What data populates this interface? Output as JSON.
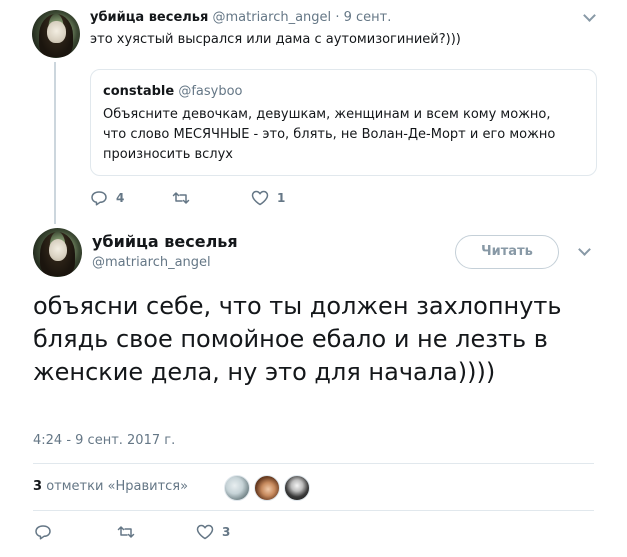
{
  "reply_tweet": {
    "author_name": "убийца веселья",
    "author_handle": "@matriarch_angel",
    "separator": "·",
    "date": "9 сент.",
    "text": "это хуястый высрался или дама с аутомизогинией?)))",
    "quoted": {
      "author_name": "constable",
      "author_handle": "@fasyboo",
      "text": "Объясните девочкам, девушкам, женщинам  и всем кому можно, что слово МЕСЯЧНЫЕ - это, блять, не Волан-Де-Морт и его можно произносить вслух"
    },
    "actions": {
      "reply_count": "4",
      "retweet_count": "",
      "like_count": "1"
    }
  },
  "main_tweet": {
    "author_name": "убийца веселья",
    "author_handle": "@matriarch_angel",
    "follow_label": "Читать",
    "text": "объясни себе, что ты должен захлопнуть блядь свое помойное ебало и не лезть в женские дела, ну это для начала))))",
    "timestamp": "4:24 - 9 сент. 2017 г.",
    "likes": {
      "count": "3",
      "label": "отметки «Нравится»"
    },
    "actions": {
      "reply_count": "",
      "retweet_count": "",
      "like_count": "3"
    }
  },
  "icons": {
    "reply": "reply-icon",
    "retweet": "retweet-icon",
    "like": "heart-icon",
    "menu": "chevron-down-icon"
  },
  "colors": {
    "text_primary": "#14171a",
    "text_secondary": "#657786",
    "border": "#e1e8ed",
    "icon": "#657786"
  }
}
